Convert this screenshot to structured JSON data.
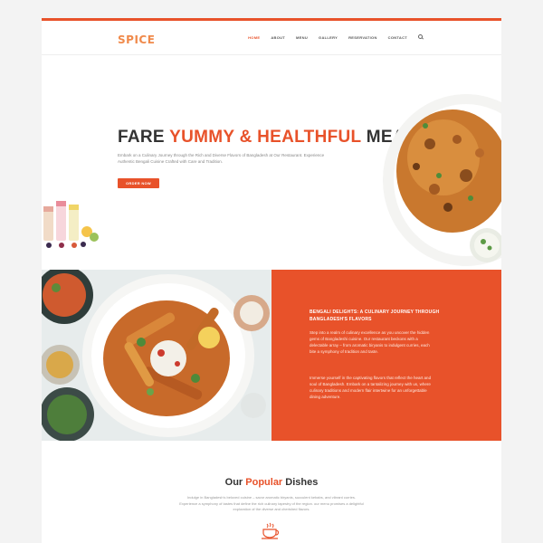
{
  "brand": {
    "logo": "SPICE",
    "accent_color": "#e8522a"
  },
  "nav": {
    "items": [
      {
        "label": "HOME",
        "active": true
      },
      {
        "label": "ABOUT"
      },
      {
        "label": "MENU"
      },
      {
        "label": "GALLERY"
      },
      {
        "label": "RESERVATION"
      },
      {
        "label": "CONTACT"
      }
    ],
    "search_icon": "search-icon"
  },
  "hero": {
    "title_part1": "FARE ",
    "title_accent": "YUMMY & HEALTHFUL",
    "title_part2": " MEALS",
    "description": "Embark on a Culinary Journey through the Rich and Diverse Flavors of Bangladesh at Our Restaurant. Experience Authentic Bengali Cuisine Crafted with Care and Tradition.",
    "button_label": "ORDER NOW"
  },
  "feature": {
    "heading": "BENGALI DELIGHTS: A CULINARY JOURNEY THROUGH BANGLADESH'S FLAVORS",
    "paragraph1": "Step into a realm of culinary excellence as you uncover the hidden gems of Bangladeshi cuisine. Our restaurant beckons with a delectable array – from aromatic biryanis to indulgent curries, each bite a symphony of tradition and taste.",
    "paragraph2": "Immerse yourself in the captivating flavors that reflect the heart and soul of Bangladesh. Embark on a tantalizing journey with us, where culinary traditions and modern flair intertwine for an unforgettable dining adventure."
  },
  "popular": {
    "title_part1": "Our ",
    "title_accent": "Popular",
    "title_part2": " Dishes",
    "description": "Indulge in Bangladesh's beloved cuisine – savor aromatic biryanis, succulent kebabs, and vibrant curries. Experience a symphony of tastes that define the rich culinary tapestry of the region. our menu promises a delightful exploration of the diverse and cherished flavors.",
    "icon": "coffee-cup-icon"
  }
}
